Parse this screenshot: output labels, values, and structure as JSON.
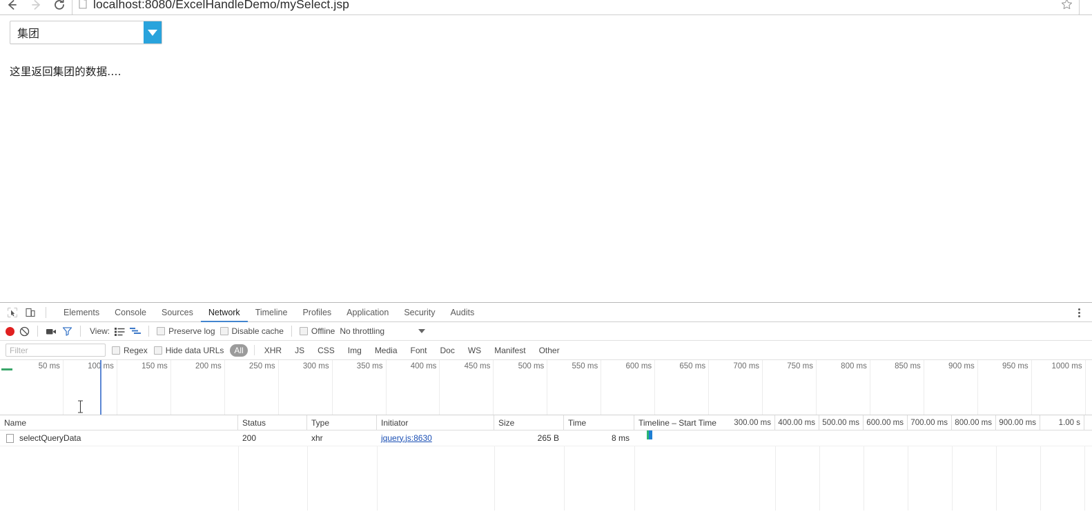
{
  "browser": {
    "url_display": "localhost:8080/ExcelHandleDemo/mySelect.jsp",
    "back_icon": "back-arrow-icon",
    "forward_icon": "forward-arrow-icon",
    "reload_icon": "reload-icon",
    "page_icon": "page-document-icon",
    "star_icon": "bookmark-star-icon"
  },
  "page": {
    "select_value": "集团",
    "select_arrow_icon": "dropdown-triangle-icon",
    "result_text": "这里返回集团的数据....",
    "accent_color": "#29a3dc"
  },
  "devtools": {
    "tabs": [
      {
        "label": "Elements",
        "active": false
      },
      {
        "label": "Console",
        "active": false
      },
      {
        "label": "Sources",
        "active": false
      },
      {
        "label": "Network",
        "active": true
      },
      {
        "label": "Timeline",
        "active": false
      },
      {
        "label": "Profiles",
        "active": false
      },
      {
        "label": "Application",
        "active": false
      },
      {
        "label": "Security",
        "active": false
      },
      {
        "label": "Audits",
        "active": false
      }
    ],
    "tab_icons": {
      "inspect": "inspect-element-icon",
      "device": "device-toolbar-icon",
      "more": "more-options-icon"
    },
    "controls": {
      "record_icon": "record-button-icon",
      "clear_icon": "clear-icon",
      "capture_screenshots_icon": "camera-icon",
      "filter_icon": "filter-funnel-icon",
      "view_label": "View:",
      "view_list_icon": "list-view-icon",
      "view_waterfall_icon": "waterfall-view-icon",
      "preserve_log": "Preserve log",
      "disable_cache": "Disable cache",
      "offline": "Offline",
      "throttling": "No throttling",
      "throttle_caret_icon": "chevron-down-icon"
    },
    "filter": {
      "placeholder": "Filter",
      "value": "",
      "regex_label": "Regex",
      "hide_data_urls_label": "Hide data URLs",
      "types": [
        "All",
        "XHR",
        "JS",
        "CSS",
        "Img",
        "Media",
        "Font",
        "Doc",
        "WS",
        "Manifest",
        "Other"
      ],
      "selected_type": "All"
    },
    "overview": {
      "ticks": [
        "50 ms",
        "100 ms",
        "150 ms",
        "200 ms",
        "250 ms",
        "300 ms",
        "350 ms",
        "400 ms",
        "450 ms",
        "500 ms",
        "550 ms",
        "600 ms",
        "650 ms",
        "700 ms",
        "750 ms",
        "800 ms",
        "850 ms",
        "900 ms",
        "950 ms",
        "1000 ms"
      ],
      "playhead_label": "100 ms",
      "cursor_icon": "text-cursor-icon"
    },
    "table": {
      "columns": [
        "Name",
        "Status",
        "Type",
        "Initiator",
        "Size",
        "Time",
        "Timeline – Start Time"
      ],
      "waterfall_ticks": [
        "300.00 ms",
        "400.00 ms",
        "500.00 ms",
        "600.00 ms",
        "700.00 ms",
        "800.00 ms",
        "900.00 ms",
        "1.00 s"
      ],
      "rows": [
        {
          "name": "selectQueryData",
          "status": "200",
          "type": "xhr",
          "initiator": "jquery.js:8630",
          "size": "265 B",
          "time": "8 ms",
          "waterfall_colors": {
            "wait": "#2bb673",
            "download": "#1f7fd4"
          }
        }
      ]
    }
  }
}
